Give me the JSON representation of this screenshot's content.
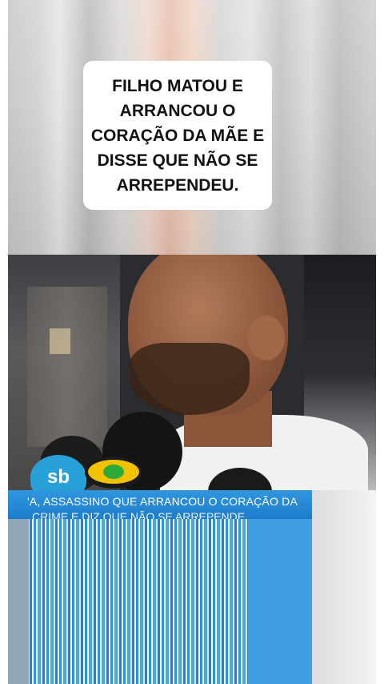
{
  "caption": {
    "text": "FILHO MATOU E\nARRANCOU O\nCORAÇÃO DA MÃE E\nDISSE QUE NÃO SE\nARREPENDEU."
  },
  "video": {
    "microphones": [
      {
        "name": "sbt-mic",
        "label": "sb"
      },
      {
        "name": "band-mic",
        "label": ""
      }
    ]
  },
  "ticker": {
    "line1": "'A, ASSASSINO QUE ARRANCOU O CORAÇÃO DA",
    "line2": "CRIME E DIZ QUE NÃO SE ARREPENDE"
  },
  "colors": {
    "ticker_blue": "#2f97de",
    "caption_bg": "#ffffff",
    "caption_text": "#111111"
  }
}
